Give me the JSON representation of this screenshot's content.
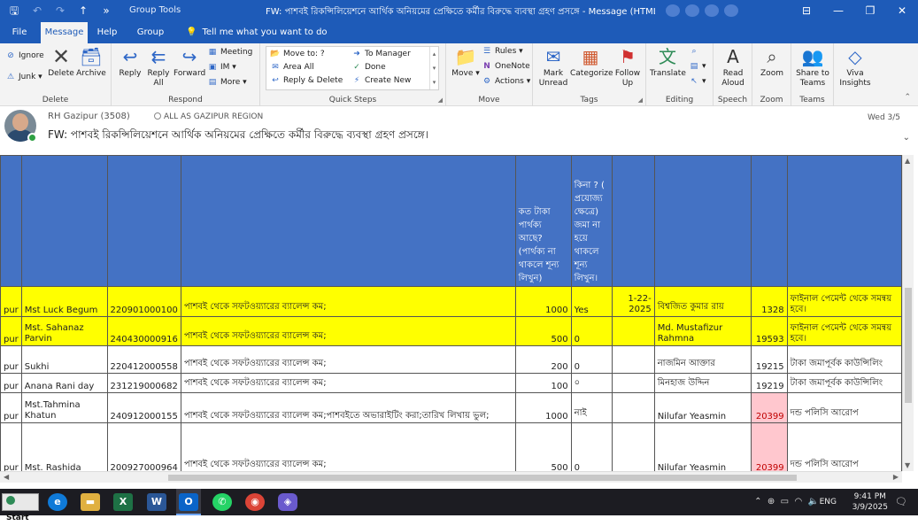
{
  "window": {
    "group_tools": "Group Tools",
    "title": "FW: পাশবই রিকন্সিলিয়েশনে আর্থিক অনিয়মের প্রেক্ষিতে কর্মীর বিরুদ্ধে ব্যবস্থা গ্রহণ প্রসঙ্গে - Message (HTML)"
  },
  "tabs": [
    {
      "label": "File"
    },
    {
      "label": "Message"
    },
    {
      "label": "Help"
    },
    {
      "label": "Group"
    }
  ],
  "tell_me": "Tell me what you want to do",
  "ribbon": {
    "delete": {
      "label": "Delete",
      "ignore": "Ignore",
      "junk": "Junk",
      "delete_btn": "Delete",
      "archive": "Archive"
    },
    "respond": {
      "label": "Respond",
      "reply": "Reply",
      "reply_all": "Reply All",
      "forward": "Forward",
      "meeting": "Meeting",
      "im": "IM",
      "more": "More"
    },
    "quick_steps": {
      "label": "Quick Steps",
      "move_to": "Move to: ?",
      "area_all": "Area All",
      "reply_delete": "Reply & Delete",
      "to_manager": "To Manager",
      "done": "Done",
      "create_new": "Create New"
    },
    "move": {
      "label": "Move",
      "move_btn": "Move",
      "rules": "Rules",
      "onenote": "OneNote",
      "actions": "Actions"
    },
    "tags": {
      "label": "Tags",
      "mark_unread": "Mark Unread",
      "categorize": "Categorize",
      "follow_up": "Follow Up"
    },
    "editing": {
      "label": "Editing",
      "translate": "Translate"
    },
    "speech": {
      "label": "Speech",
      "read_aloud": "Read Aloud"
    },
    "zoom": {
      "label": "Zoom",
      "zoom_btn": "Zoom"
    },
    "teams": {
      "label": "Teams",
      "share": "Share to Teams"
    },
    "viva": {
      "label": "Viva Insights"
    }
  },
  "message": {
    "sender": "RH Gazipur (3508)",
    "to": "ALL AS GAZIPUR REGION",
    "subject": "FW: পাশবই রিকন্সিলিয়েশনে আর্থিক অনিয়মের প্রেক্ষিতে কর্মীর বিরুদ্ধে ব্যবস্থা গ্রহণ প্রসঙ্গে।",
    "date": "Wed 3/5"
  },
  "table": {
    "header": {
      "amount_col": "কত টাকা পার্থক্য আছে? (পার্থক্য না থাকলে শূন্য লিখুন)",
      "deposit_col": "কিনা ? ( প্রযোজ্য ক্ষেত্রে) জমা না হয়ে থাকলে শূন্য লিখুন।"
    },
    "rows": [
      {
        "c0": "pur",
        "name": "Mst Luck Begum",
        "acct": "220901000100",
        "issue": "পাশবই থেকে সফটওয়্যারের ব্যালেন্স কম;",
        "amount": "1000",
        "deposit": "Yes",
        "date": "1-22-2025",
        "officer": "বিশ্বজিত কুমার রায়",
        "pin": "1328",
        "action": "ফাইনাল পেমেন্ট থেকে সমন্বয় হবে।"
      },
      {
        "c0": "pur",
        "name": "Mst. Sahanaz Parvin",
        "acct": "240430000916",
        "issue": "পাশবই থেকে সফটওয়্যারের ব্যালেন্স কম;",
        "amount": "500",
        "deposit": "0",
        "date": "",
        "officer": "Md. Mustafizur Rahmna",
        "pin": "19593",
        "action": "ফাইনাল পেমেন্ট থেকে সমন্বয় হবে।"
      },
      {
        "c0": "pur",
        "name": "Sukhi",
        "acct": "220412000558",
        "issue": "পাশবই থেকে সফটওয়্যারের ব্যালেন্স কম;",
        "amount": "200",
        "deposit": "0",
        "date": "",
        "officer": "নাজমিন আক্তার",
        "pin": "19215",
        "action": "টাকা জমাপূর্বক কাউন্সিলিং"
      },
      {
        "c0": "pur",
        "name": "Anana Rani day",
        "acct": "231219000682",
        "issue": "পাশবই থেকে সফটওয়্যারের ব্যালেন্স কম;",
        "amount": "100",
        "deposit": "০",
        "date": "",
        "officer": "মিনহাজ উদ্দিন",
        "pin": "19219",
        "action": "টাকা জমাপূর্বক কাউন্সিলিং"
      },
      {
        "c0": "pur",
        "name": "Mst.Tahmina Khatun",
        "acct": "240912000155",
        "issue": "পাশবই থেকে সফটওয়্যারের ব্যালেন্স কম;পাশবইতে অভারাইটিং করা;তারিখ লিখায় ভুল;",
        "amount": "1000",
        "deposit": "নাই",
        "date": "",
        "officer": "Nilufar Yeasmin",
        "pin": "20399",
        "action": "দন্ড পলিসি আরোপ"
      },
      {
        "c0": "pur",
        "name": "Mst. Rashida",
        "acct": "200927000964",
        "issue": "পাশবই থেকে সফটওয়্যারের ব্যালেন্স কম;",
        "amount": "500",
        "deposit": "0",
        "date": "",
        "officer": "Nilufar Yeasmin",
        "pin": "20399",
        "action": "দন্ড পলিসি আরোপ"
      }
    ]
  },
  "taskbar": {
    "start": "Start",
    "lang": "ENG",
    "time": "9:41 PM",
    "date": "3/9/2025"
  },
  "colors": {
    "accent": "#1e5bb8",
    "table_header": "#4472c4",
    "highlight_yellow": "#ffff00",
    "pink_cell": "#ffc7ce"
  }
}
